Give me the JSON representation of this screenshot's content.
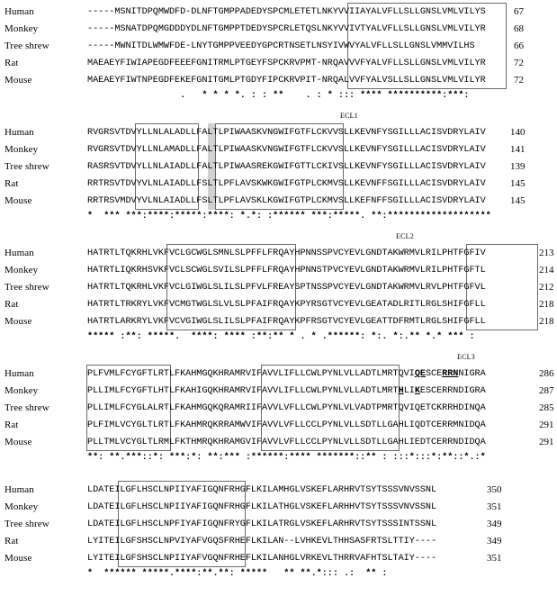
{
  "figure": {
    "type": "multiple-sequence-alignment",
    "species": [
      "Human",
      "Monkey",
      "Tree shrew",
      "Rat",
      "Mouse"
    ],
    "domain_labels": [
      "ECL1",
      "ECL2",
      "ECL3"
    ],
    "conservation_symbols": {
      "identical": "*",
      "strong": ":",
      "weak": "."
    }
  },
  "blocks": [
    {
      "id": "block1",
      "ecl": null,
      "rows": [
        {
          "name": "Human",
          "seq": "-----MSNITDPQMWDFD-DLNFTGMPPADEDYSPCMLETETLNKYVVIIAYALVFLLSLLGNSLVMLVILYS",
          "num": "67"
        },
        {
          "name": "Monkey",
          "seq": "-----MSNATDPQMGDDDYDLNFTGMPPTDEDYSPCRLETQSLNKYVVIVTYALVFLLSLLGNSLVMLVILYR",
          "num": "68"
        },
        {
          "name": "Tree shrew",
          "seq": "-----MWNITDLWMWFDE-LNYTGMPPVEEDYGPCRTNSETLNSYIVWVYALVFLLSLLGNSLVMMVILHS",
          "num": "66"
        },
        {
          "name": "Rat",
          "seq": "MAEAEYFIWIAPEGDFEEEFGNITRMLPTGEYFSPCKRVPMT-NRQAVVVFYALVFLLSLLGNSLVMLVILYR",
          "num": "72"
        },
        {
          "name": "Mouse",
          "seq": "MAEAEYFIWTNPEGDFEKEFGNITGMLPTGDYFIPCKRVPIT-NRQALVVFYALVSLLSLLGNSLVMLVILYR",
          "num": "72"
        }
      ],
      "consensus": "                 .   * * * *. : : **    . : * ::: **** **********:***:"
    },
    {
      "id": "block2",
      "ecl": "ECL1",
      "rows": [
        {
          "name": "Human",
          "seq": "RVGRSVTDVYLLNLALADLLFALTLPIWAASKVNGWIFGTFLCKVVSLLKEVNFYSGILLLACISVDRYLAIV",
          "num": "140"
        },
        {
          "name": "Monkey",
          "seq": "RVGRSVTDVYLLNLAMADLLFALTLPIWAASKVNGWIFGTFLCKVVSLLKEVNFYSGILLLACISVDRYLAIV",
          "num": "141"
        },
        {
          "name": "Tree shrew",
          "seq": "RASRSVTDVYLLNLAIADLLFALTLPIWAASREKGWIFGTTLCKIVSLLKEVNFYSGILLLACISVDRYLAIV",
          "num": "139"
        },
        {
          "name": "Rat",
          "seq": "RRTRSVTDVYVLNLAIADLLFSLTLPFLAVSKWKGWIFGTPLCKMVSLLKEVNFFSGILLLACISVDRYLAIV",
          "num": "145"
        },
        {
          "name": "Mouse",
          "seq": "RRTRSVMDVYVLNLAIADLLFSLTLPFLAVSKLKGWIFGTPLCKMVSLLKEFNFFSGILLLACISVDRYLAIV",
          "num": "145"
        }
      ],
      "consensus": "*  *** ***:****:*****:****: *.*: :****** ***:*****. **:*******************"
    },
    {
      "id": "block3",
      "ecl": "ECL2",
      "rows": [
        {
          "name": "Human",
          "seq": "HATRTLTQKRHLVKFVCLGCWGLSMNLSLPFFLFRQAYHPNNSSPVCYEVLGNDTAKWRMVLRILPHTFGFIV",
          "num": "213"
        },
        {
          "name": "Monkey",
          "seq": "HATRTLIQKRHSVKFVCLSCWGLSVILSLPFFLFRQAYHPNNSTPVCYEVLGNDTAKWRMVLRILPHTFGFTL",
          "num": "214"
        },
        {
          "name": "Tree shrew",
          "seq": "HATRTLTQKRHLVKFVCLGIWGLSLILSLPFVLFREAYSPTNSSPVCYEVLGNDTAKWRMVLRVLPHTFGFVL",
          "num": "212"
        },
        {
          "name": "Rat",
          "seq": "HATRTLTRKRYLVKFVCMGTWGLSLVLSLPFAIFRQAYKPYRSGTVCYEVLGEATADLRITLRGLSHIFGFLL",
          "num": "218"
        },
        {
          "name": "Mouse",
          "seq": "HATRTLARKRYLVKFVCVGIWGLSLILSLPFAIFRQAYKPFRSGTVCYEVLGEATTDFRMTLRGLSHIFGFLL",
          "num": "218"
        }
      ],
      "consensus": "***** :**: *****.  ****: **** :**:** * . * .******: *:. *:.** *.* *** :"
    },
    {
      "id": "block4",
      "ecl": "ECL3",
      "rows": [
        {
          "name": "Human",
          "seq": "PLFVMLFCYGFTLRTLFKAHMGQKHRAMRVIFAVVLIFLLCWLPYNLVLLADTLMRTQVI",
          "seq_marked_1": "QE",
          "seq_mid": "SCE",
          "seq_marked_2": "RRN",
          "seq_tail": "NIGRA",
          "num": "286"
        },
        {
          "name": "Monkey",
          "seq": "PLLIMLFCYGFTLHTLFKAHIGQKHRAMRVIFAVVLIFLLCWLPYNLVLLADTLMRT",
          "seq_marked_1": "H",
          "seq_mid": "LI",
          "seq_marked_2": "K",
          "seq_tail": "ESCERRNDIGRA",
          "num": "287"
        },
        {
          "name": "Tree shrew",
          "seq": "PLLIMLFCYGLALRTLFKAHMGQKQRAMRIIFAVVLVFLLCWLPYNLVLVADTPMRTQVIQETCKRRHDINQA",
          "num": "285"
        },
        {
          "name": "Rat",
          "seq": "PLFIMLVCYGLTLRTLFKAHMRQKRRAMWVIFAVVLVFLLCCLPYNLVLLSDTLLGAHLIQDTCERRMNIDQA",
          "num": "291"
        },
        {
          "name": "Mouse",
          "seq": "PLLTMLVCYGLTLRMLFKTHMRQKHRAMGVIFAVVLVFLLCCLPYNLVLLSDTLLGAHLIEDTCERRNDIDQA",
          "num": "291"
        }
      ],
      "consensus": "**: **.***::*: ***:*: **:*** :******:**** *******::** : :::*:::*:**::*.:*"
    },
    {
      "id": "block5",
      "ecl": null,
      "rows": [
        {
          "name": "Human",
          "seq": "LDATEILGFLHSCLNPIIYAFIGQNFRHGFLKILAMHGLVSKEFLARHRVTSYTSSSVNVSSNL",
          "num": "350"
        },
        {
          "name": "Monkey",
          "seq": "LDATEILGFLHSCLNPIIYAFIGQNFRHGFLKILATHGLVSKEFLARHHVTSYTSSSVNVSSNL",
          "num": "351"
        },
        {
          "name": "Tree shrew",
          "seq": "LDATEILGFLHSCLNPFIYAFIGQNFRYGFLKILATRGLVSKEFLARHRVTSYTSSSINTSSNL",
          "num": "349"
        },
        {
          "name": "Rat",
          "seq": "LYITEILGFSHSCLNPVIYAFVGQSFRHEFLKILAN--LVHKEVLTHHSASFRTSLTTIY----",
          "num": "349"
        },
        {
          "name": "Mouse",
          "seq": "LYITEILGFSHSCLNPIIYAFVGQNFRHEFLKILANHGLVRKEVLTHRRVAFHTSLTAIY----",
          "num": "351"
        }
      ],
      "consensus": "*  ****** *****.****:**.**: *****   ** **.*::: .:  ** :"
    }
  ]
}
